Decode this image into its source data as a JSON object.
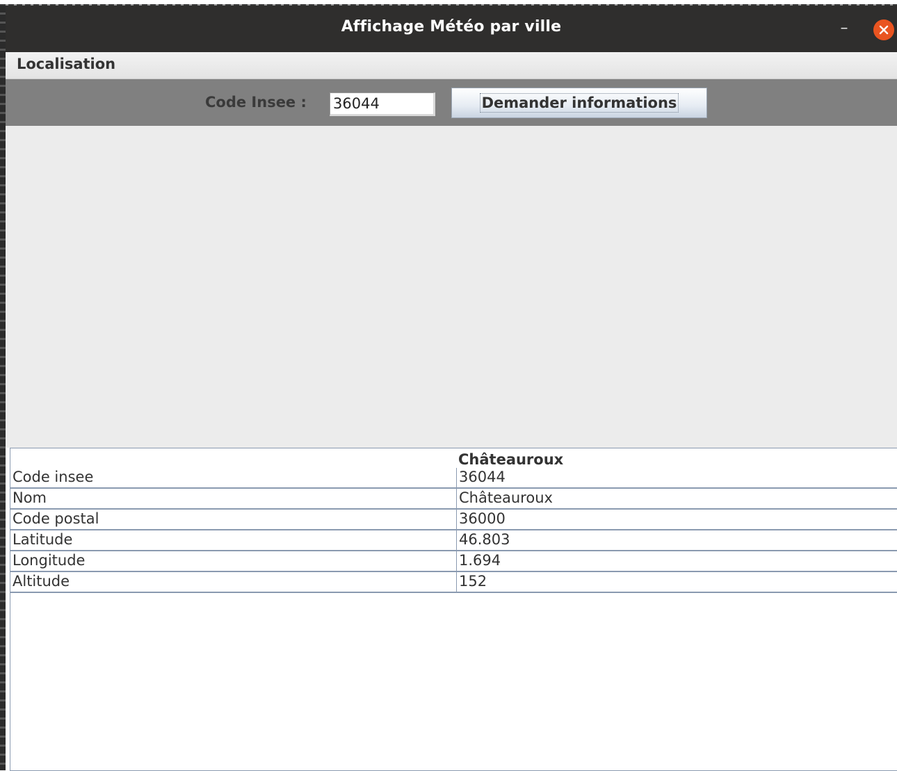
{
  "window": {
    "title": "Affichage Météo par ville"
  },
  "menubar": {
    "items": [
      {
        "label": "Localisation"
      }
    ]
  },
  "toolbar": {
    "code_label": "Code Insee :",
    "code_value": "36044",
    "submit_label": "Demander informations"
  },
  "table": {
    "column_header": "Châteauroux",
    "rows": [
      {
        "key": "Code insee",
        "value": "36044"
      },
      {
        "key": "Nom",
        "value": "Châteauroux"
      },
      {
        "key": "Code postal",
        "value": "36000"
      },
      {
        "key": "Latitude",
        "value": "46.803"
      },
      {
        "key": "Longitude",
        "value": "1.694"
      },
      {
        "key": "Altitude",
        "value": "152"
      }
    ]
  },
  "colors": {
    "titlebar": "#2f2e2d",
    "close_button": "#e95420",
    "toolbar": "#808080",
    "center_panel": "#ececec",
    "grid_lines": "#8a9ab0"
  },
  "icons": {
    "minimize": "minimize-icon",
    "close": "close-icon"
  }
}
